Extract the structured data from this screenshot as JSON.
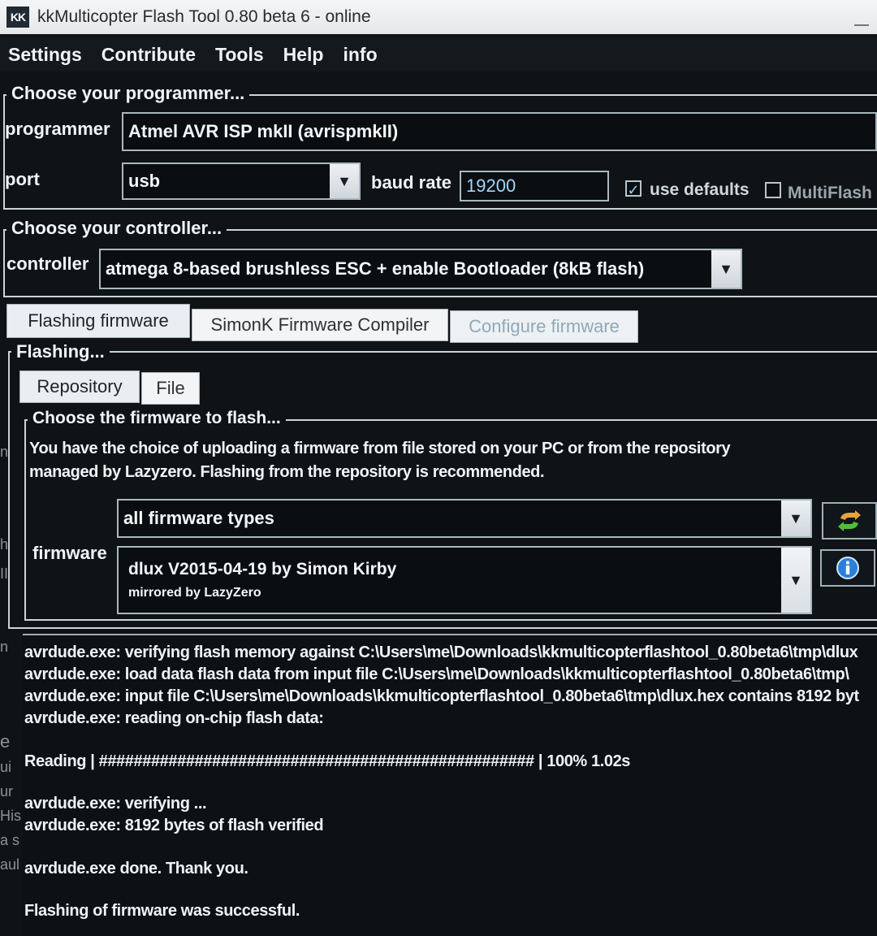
{
  "window": {
    "title": "kkMulticopter Flash Tool 0.80 beta 6 - online",
    "icon_text": "KK"
  },
  "menu": {
    "items": [
      "Settings",
      "Contribute",
      "Tools",
      "Help",
      "info"
    ]
  },
  "programmer_panel": {
    "legend": "Choose your programmer...",
    "programmer_label": "programmer",
    "programmer_value": "Atmel AVR ISP mkII (avrispmkII)",
    "port_label": "port",
    "port_value": "usb",
    "baud_label": "baud rate",
    "baud_value": "19200",
    "use_defaults_label": "use defaults",
    "use_defaults_checked": true,
    "multiflash_label": "MultiFlash",
    "multiflash_checked": false
  },
  "controller_panel": {
    "legend": "Choose your controller...",
    "controller_label": "controller",
    "controller_value": "atmega 8-based brushless ESC + enable Bootloader (8kB flash)"
  },
  "main_tabs": [
    "Flashing firmware",
    "SimonK Firmware Compiler",
    "Configure firmware"
  ],
  "flashing": {
    "legend": "Flashing...",
    "sub_tabs": [
      "Repository",
      "File"
    ],
    "firmware_legend": "Choose the firmware to flash...",
    "description_line1": "You have the choice of uploading a firmware from file stored on your PC or from the repository",
    "description_line2": "managed by Lazyzero. Flashing from the repository is recommended.",
    "filter_value": "all firmware types",
    "firmware_label": "firmware",
    "firmware_name": "dlux V2015-04-19  by Simon Kirby",
    "firmware_mirror": "mirrored by LazyZero"
  },
  "icons": {
    "refresh": "refresh-icon",
    "info": "info-icon"
  },
  "log": {
    "lines": [
      "avrdude.exe: verifying flash memory against C:\\Users\\me\\Downloads\\kkmulticopterflashtool_0.80beta6\\tmp\\dlux",
      "avrdude.exe: load data flash data from input file C:\\Users\\me\\Downloads\\kkmulticopterflashtool_0.80beta6\\tmp\\",
      "avrdude.exe: input file C:\\Users\\me\\Downloads\\kkmulticopterflashtool_0.80beta6\\tmp\\dlux.hex contains 8192 byt",
      "avrdude.exe: reading on-chip flash data:",
      "Reading | ################################################## | 100% 1.02s",
      "avrdude.exe: verifying ...",
      "avrdude.exe: 8192 bytes of flash verified",
      "avrdude.exe done.  Thank you.",
      "Flashing of firmware was successful."
    ]
  },
  "background_fragments": [
    "n",
    "h",
    "II",
    "n",
    "e",
    "ui",
    "ur",
    "His",
    "a s",
    "aul"
  ],
  "colors": {
    "accent": "#2c9be0",
    "refresh_orange": "#e8a23a",
    "refresh_green": "#4fbf3a"
  }
}
